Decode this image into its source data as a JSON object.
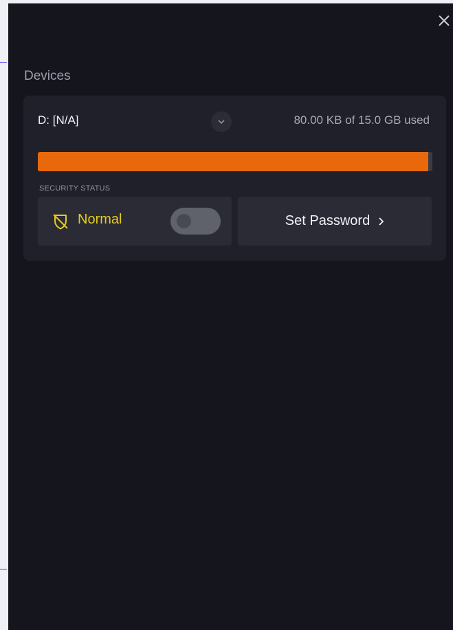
{
  "panel": {
    "close_icon": "close-icon",
    "section_title": "Devices"
  },
  "device": {
    "name": "D: [N/A]",
    "expand_icon": "chevron-down-icon",
    "usage_text": "80.00 KB of 15.0 GB used",
    "usage_fill_fraction": 0.99,
    "usage_color": "#e8690b",
    "security": {
      "label": "SECURITY STATUS",
      "status_icon": "shield-off-icon",
      "status_text": "Normal",
      "status_color": "#e6cc19",
      "toggle_on": false
    },
    "set_password": {
      "label": "Set Password",
      "icon": "chevron-right-icon"
    }
  },
  "colors": {
    "panel_bg": "#15151d",
    "card_bg": "#1f2029",
    "control_bg": "#2a2b35"
  }
}
